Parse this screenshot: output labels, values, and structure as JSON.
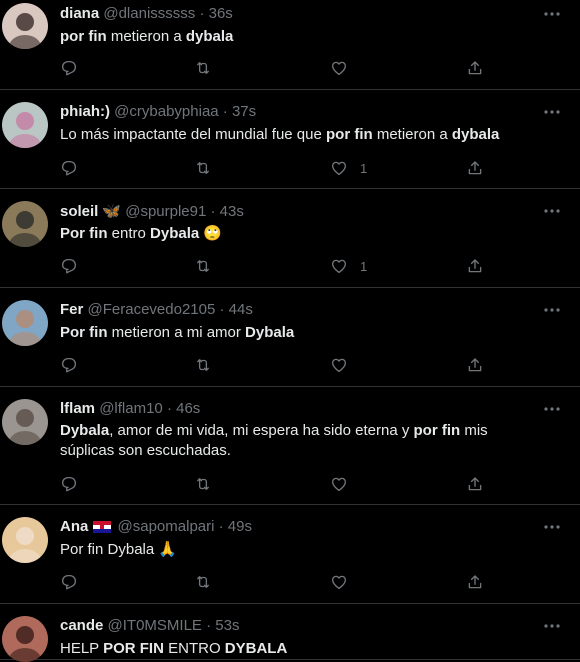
{
  "tweets": [
    {
      "name": "diana",
      "handle": "@dlanissssss",
      "time": "36s",
      "segments": [
        {
          "t": "por fin",
          "b": true
        },
        {
          "t": " metieron a ",
          "b": false
        },
        {
          "t": "dybala",
          "b": true
        }
      ],
      "like_count": "",
      "avatar_colors": [
        "#d8c8c0",
        "#3a2a28"
      ]
    },
    {
      "name": "phiah:)",
      "handle": "@crybabyphiaa",
      "time": "37s",
      "segments": [
        {
          "t": "Lo más impactante del mundial fue que ",
          "b": false
        },
        {
          "t": "por fin",
          "b": true
        },
        {
          "t": " metieron a ",
          "b": false
        },
        {
          "t": "dybala",
          "b": true
        }
      ],
      "like_count": "1",
      "avatar_colors": [
        "#b9c6c4",
        "#c77aa3"
      ]
    },
    {
      "name": "soleil",
      "name_emoji": "🦋",
      "handle": "@spurple91",
      "time": "43s",
      "segments": [
        {
          "t": "Por fin",
          "b": true
        },
        {
          "t": " entro ",
          "b": false
        },
        {
          "t": "Dybala",
          "b": true
        },
        {
          "t": " 🙄",
          "b": false
        }
      ],
      "like_count": "1",
      "avatar_colors": [
        "#8a7a5a",
        "#2b2b2b"
      ]
    },
    {
      "name": "Fer",
      "handle": "@Feracevedo2105",
      "time": "44s",
      "segments": [
        {
          "t": "Por fin",
          "b": true
        },
        {
          "t": " metieron a mi amor ",
          "b": false
        },
        {
          "t": "Dybala",
          "b": true
        }
      ],
      "like_count": "",
      "avatar_colors": [
        "#7fa6c4",
        "#b78a70"
      ]
    },
    {
      "name": "lflam",
      "handle": "@lflam10",
      "time": "46s",
      "segments": [
        {
          "t": "Dybala",
          "b": true
        },
        {
          "t": ", amor de mi vida, mi espera ha sido eterna y ",
          "b": false
        },
        {
          "t": "por fin",
          "b": true
        },
        {
          "t": " mis súplicas son escuchadas.",
          "b": false
        }
      ],
      "like_count": "",
      "avatar_colors": [
        "#9a9590",
        "#5a4e46"
      ]
    },
    {
      "name": "Ana",
      "handle": "@sapomalpari",
      "time": "49s",
      "segments": [
        {
          "t": "Por fin Dybala ",
          "b": false
        },
        {
          "t": "🙏",
          "b": false
        }
      ],
      "like_count": "",
      "avatar_colors": [
        "#e6c89a",
        "#f1e0cf"
      ]
    },
    {
      "name": "cande",
      "handle": "@IT0MSMILE",
      "time": "53s",
      "segments": [
        {
          "t": "HELP ",
          "b": false
        },
        {
          "t": "POR FIN",
          "b": true
        },
        {
          "t": " ENTRO ",
          "b": false
        },
        {
          "t": "DYBALA",
          "b": true
        }
      ],
      "like_count": "",
      "avatar_colors": [
        "#b06a5c",
        "#3a1c18"
      ]
    }
  ],
  "icons": {
    "reply": "reply-icon",
    "retweet": "retweet-icon",
    "like": "heart-icon",
    "share": "share-icon",
    "more": "more-icon"
  },
  "colors": {
    "background": "#000000",
    "text": "#e7e9ea",
    "muted": "#71767b",
    "divider": "#2f3336"
  }
}
